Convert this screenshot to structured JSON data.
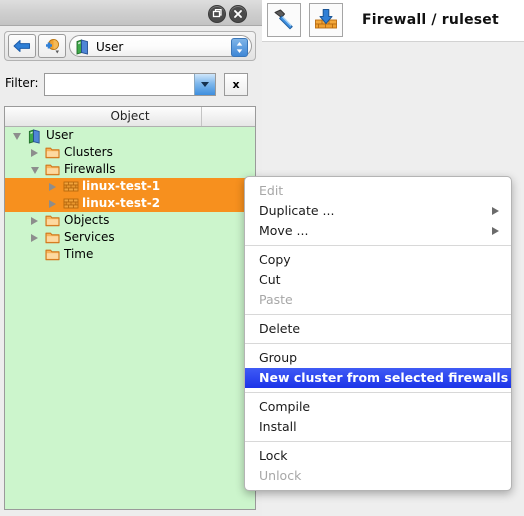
{
  "panel": {
    "titlebar": {
      "float_button": "float-restore",
      "close_button": "close"
    },
    "nav": {
      "back_icon": "back-arrow-icon",
      "new_object_icon": "new-object-icon",
      "combo_icon": "library-book-icon",
      "combo_value": "User"
    },
    "filter": {
      "label": "Filter:",
      "value": "",
      "placeholder": "",
      "clear_label": "x",
      "dropdown_icon": "chevron-down-icon"
    },
    "tree": {
      "column_header": "Object",
      "background_color": "#ccf5cc",
      "selection_color": "#f7901e",
      "nodes": [
        {
          "label": "User",
          "icon": "library-book-icon",
          "depth": 0,
          "twisty": "open",
          "selected": false
        },
        {
          "label": "Clusters",
          "icon": "folder-icon",
          "depth": 1,
          "twisty": "closed",
          "selected": false
        },
        {
          "label": "Firewalls",
          "icon": "folder-icon",
          "depth": 1,
          "twisty": "open",
          "selected": false
        },
        {
          "label": "linux-test-1",
          "icon": "firewall-icon",
          "depth": 2,
          "twisty": "closed",
          "selected": true
        },
        {
          "label": "linux-test-2",
          "icon": "firewall-icon",
          "depth": 2,
          "twisty": "closed",
          "selected": true
        },
        {
          "label": "Objects",
          "icon": "folder-icon",
          "depth": 1,
          "twisty": "closed",
          "selected": false
        },
        {
          "label": "Services",
          "icon": "folder-icon",
          "depth": 1,
          "twisty": "closed",
          "selected": false
        },
        {
          "label": "Time",
          "icon": "folder-icon",
          "depth": 1,
          "twisty": "none",
          "selected": false
        }
      ]
    }
  },
  "header": {
    "compile_icon": "hammer-icon",
    "install_icon": "install-firewall-icon",
    "title": "Firewall / ruleset"
  },
  "context_menu": {
    "highlight_color": "#2a43f0",
    "items": [
      {
        "label": "Edit",
        "state": "disabled",
        "submenu": false
      },
      {
        "label": "Duplicate ...",
        "state": "normal",
        "submenu": true
      },
      {
        "label": "Move ...",
        "state": "normal",
        "submenu": true
      },
      {
        "separator": true
      },
      {
        "label": "Copy",
        "state": "normal",
        "submenu": false
      },
      {
        "label": "Cut",
        "state": "normal",
        "submenu": false
      },
      {
        "label": "Paste",
        "state": "disabled",
        "submenu": false
      },
      {
        "separator": true
      },
      {
        "label": "Delete",
        "state": "normal",
        "submenu": false
      },
      {
        "separator": true
      },
      {
        "label": "Group",
        "state": "normal",
        "submenu": false
      },
      {
        "label": "New cluster from selected firewalls",
        "state": "highlight",
        "submenu": false
      },
      {
        "separator": true
      },
      {
        "label": "Compile",
        "state": "normal",
        "submenu": false
      },
      {
        "label": "Install",
        "state": "normal",
        "submenu": false
      },
      {
        "separator": true
      },
      {
        "label": "Lock",
        "state": "normal",
        "submenu": false
      },
      {
        "label": "Unlock",
        "state": "disabled",
        "submenu": false
      }
    ]
  }
}
